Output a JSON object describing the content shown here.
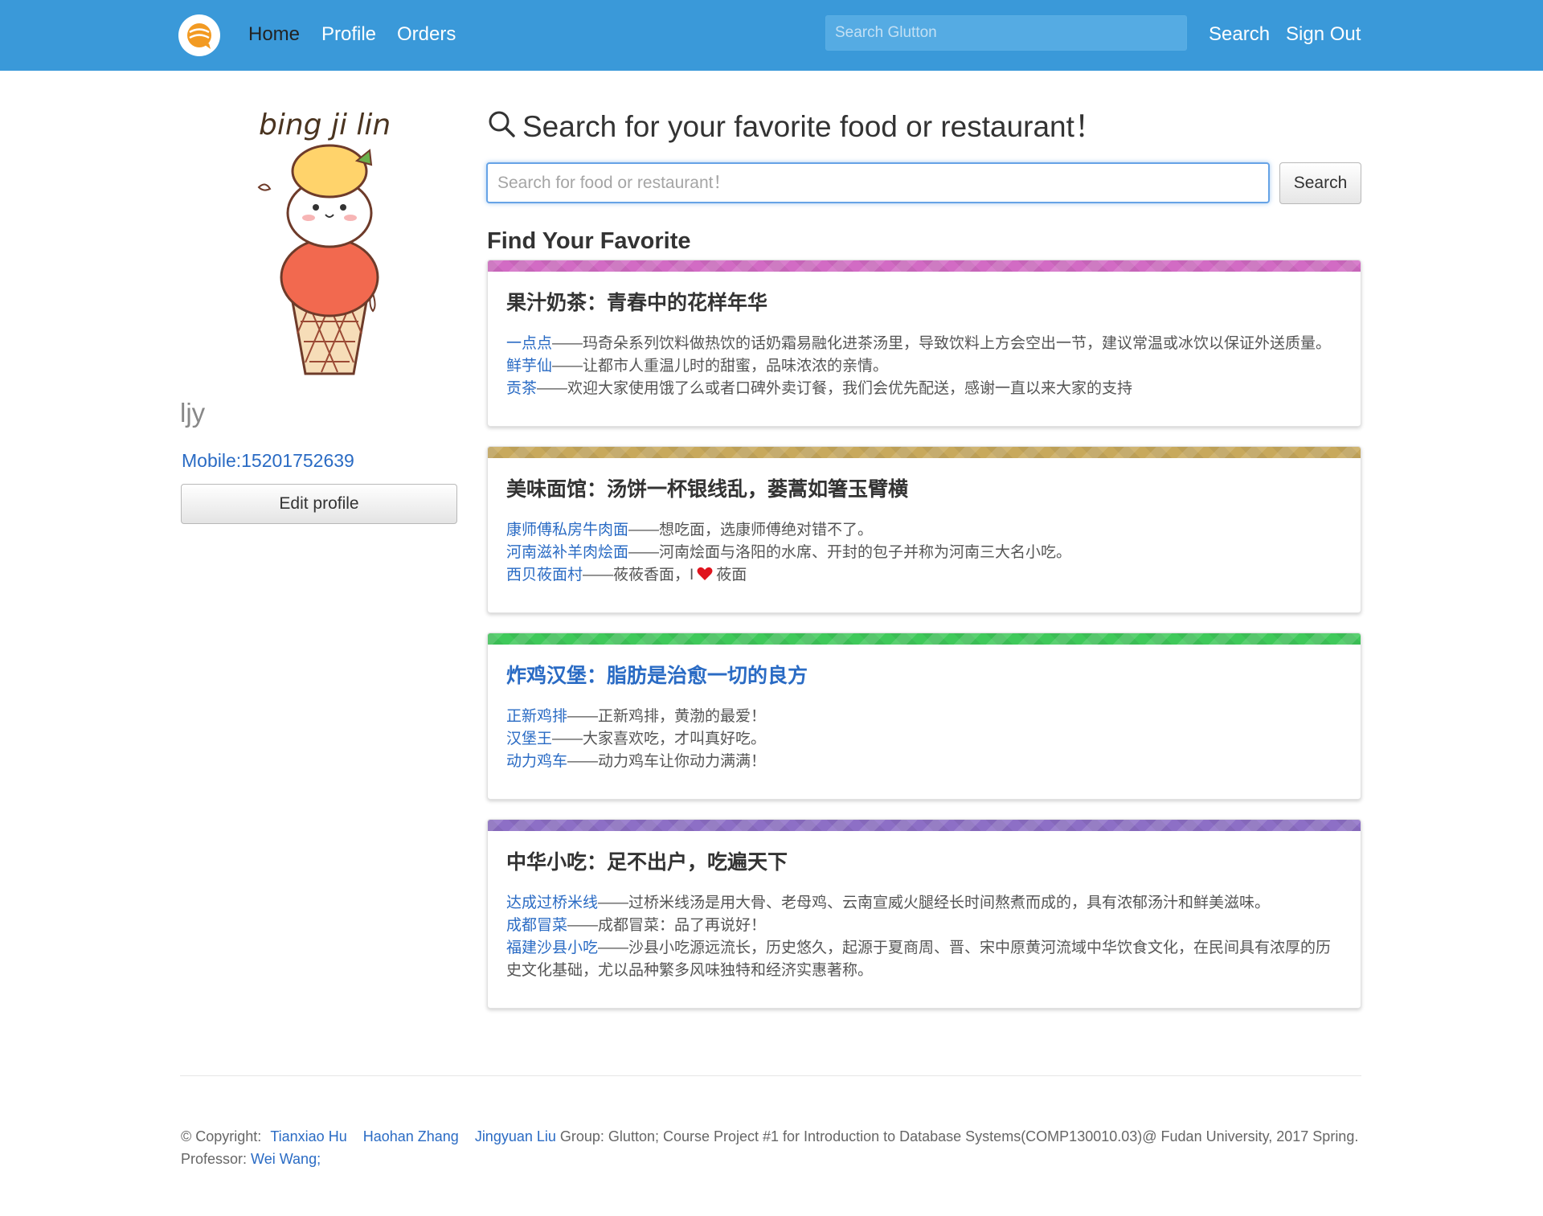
{
  "navbar": {
    "links": {
      "home": "Home",
      "profile": "Profile",
      "orders": "Orders"
    },
    "search_placeholder": "Search Glutton",
    "search_label": "Search",
    "signout_label": "Sign Out"
  },
  "sidebar": {
    "username": "ljy",
    "mobile": "Mobile:15201752639",
    "edit_label": "Edit profile"
  },
  "main": {
    "search_heading": "Search for your favorite food or restaurant！",
    "search_placeholder": "Search for food or restaurant！",
    "search_button": "Search",
    "section_title": "Find Your Favorite",
    "cards": [
      {
        "title": "果汁奶茶：青春中的花样年华",
        "stripe_color": "#d26bc4",
        "items": [
          {
            "shop": "一点点",
            "desc": "——玛奇朵系列饮料做热饮的话奶霜易融化进茶汤里，导致饮料上方会空出一节，建议常温或冰饮以保证外送质量。"
          },
          {
            "shop": "鲜芋仙",
            "desc": "——让都市人重温儿时的甜蜜，品味浓浓的亲情。"
          },
          {
            "shop": "贡茶",
            "desc": "——欢迎大家使用饿了么或者口碑外卖订餐，我们会优先配送，感谢一直以来大家的支持"
          }
        ]
      },
      {
        "title": "美味面馆：汤饼一杯银线乱，蒌蒿如箸玉臂横",
        "stripe_color": "#c8a95c",
        "items": [
          {
            "shop": "康师傅私房牛肉面",
            "desc": "——想吃面，选康师傅绝对错不了。"
          },
          {
            "shop": "河南滋补羊肉烩面",
            "desc": "——河南烩面与洛阳的水席、开封的包子并称为河南三大名小吃。"
          },
          {
            "shop": "西贝莜面村",
            "desc": "——莜莜香面，I",
            "after": "莜面"
          }
        ]
      },
      {
        "title": "炸鸡汉堡：脂肪是治愈一切的良方",
        "stripe_color": "#3fc95a",
        "items": [
          {
            "shop": "正新鸡排",
            "desc": "——正新鸡排，黄渤的最爱！"
          },
          {
            "shop": "汉堡王",
            "desc": "——大家喜欢吃，才叫真好吃。"
          },
          {
            "shop": "动力鸡车",
            "desc": "——动力鸡车让你动力满满！"
          }
        ]
      },
      {
        "title": "中华小吃：足不出户，吃遍天下",
        "stripe_color": "#8d6fc6",
        "items": [
          {
            "shop": "达成过桥米线",
            "desc": "——过桥米线汤是用大骨、老母鸡、云南宣威火腿经长时间熬煮而成的，具有浓郁汤汁和鲜美滋味。"
          },
          {
            "shop": "成都冒菜",
            "desc": "——成都冒菜：品了再说好！"
          },
          {
            "shop": "福建沙县小吃",
            "desc": "——沙县小吃源远流长，历史悠久，起源于夏商周、晋、宋中原黄河流域中华饮食文化，在民间具有浓厚的历史文化基础，尤以品种繁多风味独特和经济实惠著称。"
          }
        ]
      }
    ]
  },
  "footer": {
    "copyright": "© Copyright:",
    "authors": [
      "Tianxiao Hu",
      "Haohan Zhang",
      "Jingyuan Liu"
    ],
    "course_text": "Group: Glutton; Course Project #1 for Introduction to Database Systems(COMP130010.03)@ Fudan University, 2017 Spring.",
    "professor_label": "Professor:",
    "professor_name": "Wei Wang;"
  },
  "colors": {
    "navbar": "#3a99d9",
    "link": "#2a6bc4"
  }
}
